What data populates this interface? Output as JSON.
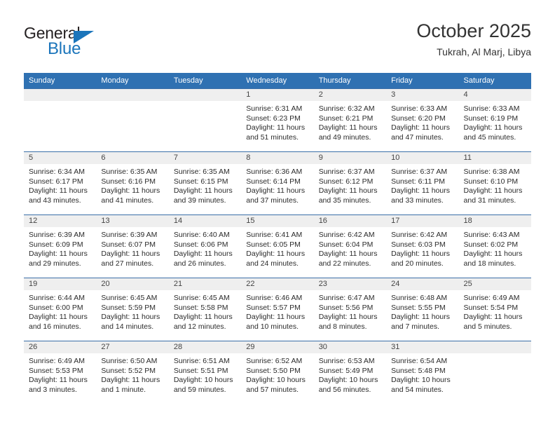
{
  "brand": {
    "name_part1": "General",
    "name_part2": "Blue"
  },
  "header": {
    "title": "October 2025",
    "subtitle": "Tukrah, Al Marj, Libya"
  },
  "colors": {
    "header_blue": "#2f71b2",
    "brand_blue": "#1b75bb",
    "daynum_background": "#efefef",
    "grid_line": "#3b6fa8"
  },
  "weekdays": [
    "Sunday",
    "Monday",
    "Tuesday",
    "Wednesday",
    "Thursday",
    "Friday",
    "Saturday"
  ],
  "labels": {
    "sunrise_prefix": "Sunrise:",
    "sunset_prefix": "Sunset:",
    "daylight_prefix": "Daylight:"
  },
  "weeks": [
    [
      {
        "day": "",
        "sunrise": "",
        "sunset": "",
        "daylight_line1": "",
        "daylight_line2": ""
      },
      {
        "day": "",
        "sunrise": "",
        "sunset": "",
        "daylight_line1": "",
        "daylight_line2": ""
      },
      {
        "day": "",
        "sunrise": "",
        "sunset": "",
        "daylight_line1": "",
        "daylight_line2": ""
      },
      {
        "day": "1",
        "sunrise": "Sunrise: 6:31 AM",
        "sunset": "Sunset: 6:23 PM",
        "daylight_line1": "Daylight: 11 hours",
        "daylight_line2": "and 51 minutes."
      },
      {
        "day": "2",
        "sunrise": "Sunrise: 6:32 AM",
        "sunset": "Sunset: 6:21 PM",
        "daylight_line1": "Daylight: 11 hours",
        "daylight_line2": "and 49 minutes."
      },
      {
        "day": "3",
        "sunrise": "Sunrise: 6:33 AM",
        "sunset": "Sunset: 6:20 PM",
        "daylight_line1": "Daylight: 11 hours",
        "daylight_line2": "and 47 minutes."
      },
      {
        "day": "4",
        "sunrise": "Sunrise: 6:33 AM",
        "sunset": "Sunset: 6:19 PM",
        "daylight_line1": "Daylight: 11 hours",
        "daylight_line2": "and 45 minutes."
      }
    ],
    [
      {
        "day": "5",
        "sunrise": "Sunrise: 6:34 AM",
        "sunset": "Sunset: 6:17 PM",
        "daylight_line1": "Daylight: 11 hours",
        "daylight_line2": "and 43 minutes."
      },
      {
        "day": "6",
        "sunrise": "Sunrise: 6:35 AM",
        "sunset": "Sunset: 6:16 PM",
        "daylight_line1": "Daylight: 11 hours",
        "daylight_line2": "and 41 minutes."
      },
      {
        "day": "7",
        "sunrise": "Sunrise: 6:35 AM",
        "sunset": "Sunset: 6:15 PM",
        "daylight_line1": "Daylight: 11 hours",
        "daylight_line2": "and 39 minutes."
      },
      {
        "day": "8",
        "sunrise": "Sunrise: 6:36 AM",
        "sunset": "Sunset: 6:14 PM",
        "daylight_line1": "Daylight: 11 hours",
        "daylight_line2": "and 37 minutes."
      },
      {
        "day": "9",
        "sunrise": "Sunrise: 6:37 AM",
        "sunset": "Sunset: 6:12 PM",
        "daylight_line1": "Daylight: 11 hours",
        "daylight_line2": "and 35 minutes."
      },
      {
        "day": "10",
        "sunrise": "Sunrise: 6:37 AM",
        "sunset": "Sunset: 6:11 PM",
        "daylight_line1": "Daylight: 11 hours",
        "daylight_line2": "and 33 minutes."
      },
      {
        "day": "11",
        "sunrise": "Sunrise: 6:38 AM",
        "sunset": "Sunset: 6:10 PM",
        "daylight_line1": "Daylight: 11 hours",
        "daylight_line2": "and 31 minutes."
      }
    ],
    [
      {
        "day": "12",
        "sunrise": "Sunrise: 6:39 AM",
        "sunset": "Sunset: 6:09 PM",
        "daylight_line1": "Daylight: 11 hours",
        "daylight_line2": "and 29 minutes."
      },
      {
        "day": "13",
        "sunrise": "Sunrise: 6:39 AM",
        "sunset": "Sunset: 6:07 PM",
        "daylight_line1": "Daylight: 11 hours",
        "daylight_line2": "and 27 minutes."
      },
      {
        "day": "14",
        "sunrise": "Sunrise: 6:40 AM",
        "sunset": "Sunset: 6:06 PM",
        "daylight_line1": "Daylight: 11 hours",
        "daylight_line2": "and 26 minutes."
      },
      {
        "day": "15",
        "sunrise": "Sunrise: 6:41 AM",
        "sunset": "Sunset: 6:05 PM",
        "daylight_line1": "Daylight: 11 hours",
        "daylight_line2": "and 24 minutes."
      },
      {
        "day": "16",
        "sunrise": "Sunrise: 6:42 AM",
        "sunset": "Sunset: 6:04 PM",
        "daylight_line1": "Daylight: 11 hours",
        "daylight_line2": "and 22 minutes."
      },
      {
        "day": "17",
        "sunrise": "Sunrise: 6:42 AM",
        "sunset": "Sunset: 6:03 PM",
        "daylight_line1": "Daylight: 11 hours",
        "daylight_line2": "and 20 minutes."
      },
      {
        "day": "18",
        "sunrise": "Sunrise: 6:43 AM",
        "sunset": "Sunset: 6:02 PM",
        "daylight_line1": "Daylight: 11 hours",
        "daylight_line2": "and 18 minutes."
      }
    ],
    [
      {
        "day": "19",
        "sunrise": "Sunrise: 6:44 AM",
        "sunset": "Sunset: 6:00 PM",
        "daylight_line1": "Daylight: 11 hours",
        "daylight_line2": "and 16 minutes."
      },
      {
        "day": "20",
        "sunrise": "Sunrise: 6:45 AM",
        "sunset": "Sunset: 5:59 PM",
        "daylight_line1": "Daylight: 11 hours",
        "daylight_line2": "and 14 minutes."
      },
      {
        "day": "21",
        "sunrise": "Sunrise: 6:45 AM",
        "sunset": "Sunset: 5:58 PM",
        "daylight_line1": "Daylight: 11 hours",
        "daylight_line2": "and 12 minutes."
      },
      {
        "day": "22",
        "sunrise": "Sunrise: 6:46 AM",
        "sunset": "Sunset: 5:57 PM",
        "daylight_line1": "Daylight: 11 hours",
        "daylight_line2": "and 10 minutes."
      },
      {
        "day": "23",
        "sunrise": "Sunrise: 6:47 AM",
        "sunset": "Sunset: 5:56 PM",
        "daylight_line1": "Daylight: 11 hours",
        "daylight_line2": "and 8 minutes."
      },
      {
        "day": "24",
        "sunrise": "Sunrise: 6:48 AM",
        "sunset": "Sunset: 5:55 PM",
        "daylight_line1": "Daylight: 11 hours",
        "daylight_line2": "and 7 minutes."
      },
      {
        "day": "25",
        "sunrise": "Sunrise: 6:49 AM",
        "sunset": "Sunset: 5:54 PM",
        "daylight_line1": "Daylight: 11 hours",
        "daylight_line2": "and 5 minutes."
      }
    ],
    [
      {
        "day": "26",
        "sunrise": "Sunrise: 6:49 AM",
        "sunset": "Sunset: 5:53 PM",
        "daylight_line1": "Daylight: 11 hours",
        "daylight_line2": "and 3 minutes."
      },
      {
        "day": "27",
        "sunrise": "Sunrise: 6:50 AM",
        "sunset": "Sunset: 5:52 PM",
        "daylight_line1": "Daylight: 11 hours",
        "daylight_line2": "and 1 minute."
      },
      {
        "day": "28",
        "sunrise": "Sunrise: 6:51 AM",
        "sunset": "Sunset: 5:51 PM",
        "daylight_line1": "Daylight: 10 hours",
        "daylight_line2": "and 59 minutes."
      },
      {
        "day": "29",
        "sunrise": "Sunrise: 6:52 AM",
        "sunset": "Sunset: 5:50 PM",
        "daylight_line1": "Daylight: 10 hours",
        "daylight_line2": "and 57 minutes."
      },
      {
        "day": "30",
        "sunrise": "Sunrise: 6:53 AM",
        "sunset": "Sunset: 5:49 PM",
        "daylight_line1": "Daylight: 10 hours",
        "daylight_line2": "and 56 minutes."
      },
      {
        "day": "31",
        "sunrise": "Sunrise: 6:54 AM",
        "sunset": "Sunset: 5:48 PM",
        "daylight_line1": "Daylight: 10 hours",
        "daylight_line2": "and 54 minutes."
      },
      {
        "day": "",
        "sunrise": "",
        "sunset": "",
        "daylight_line1": "",
        "daylight_line2": ""
      }
    ]
  ]
}
